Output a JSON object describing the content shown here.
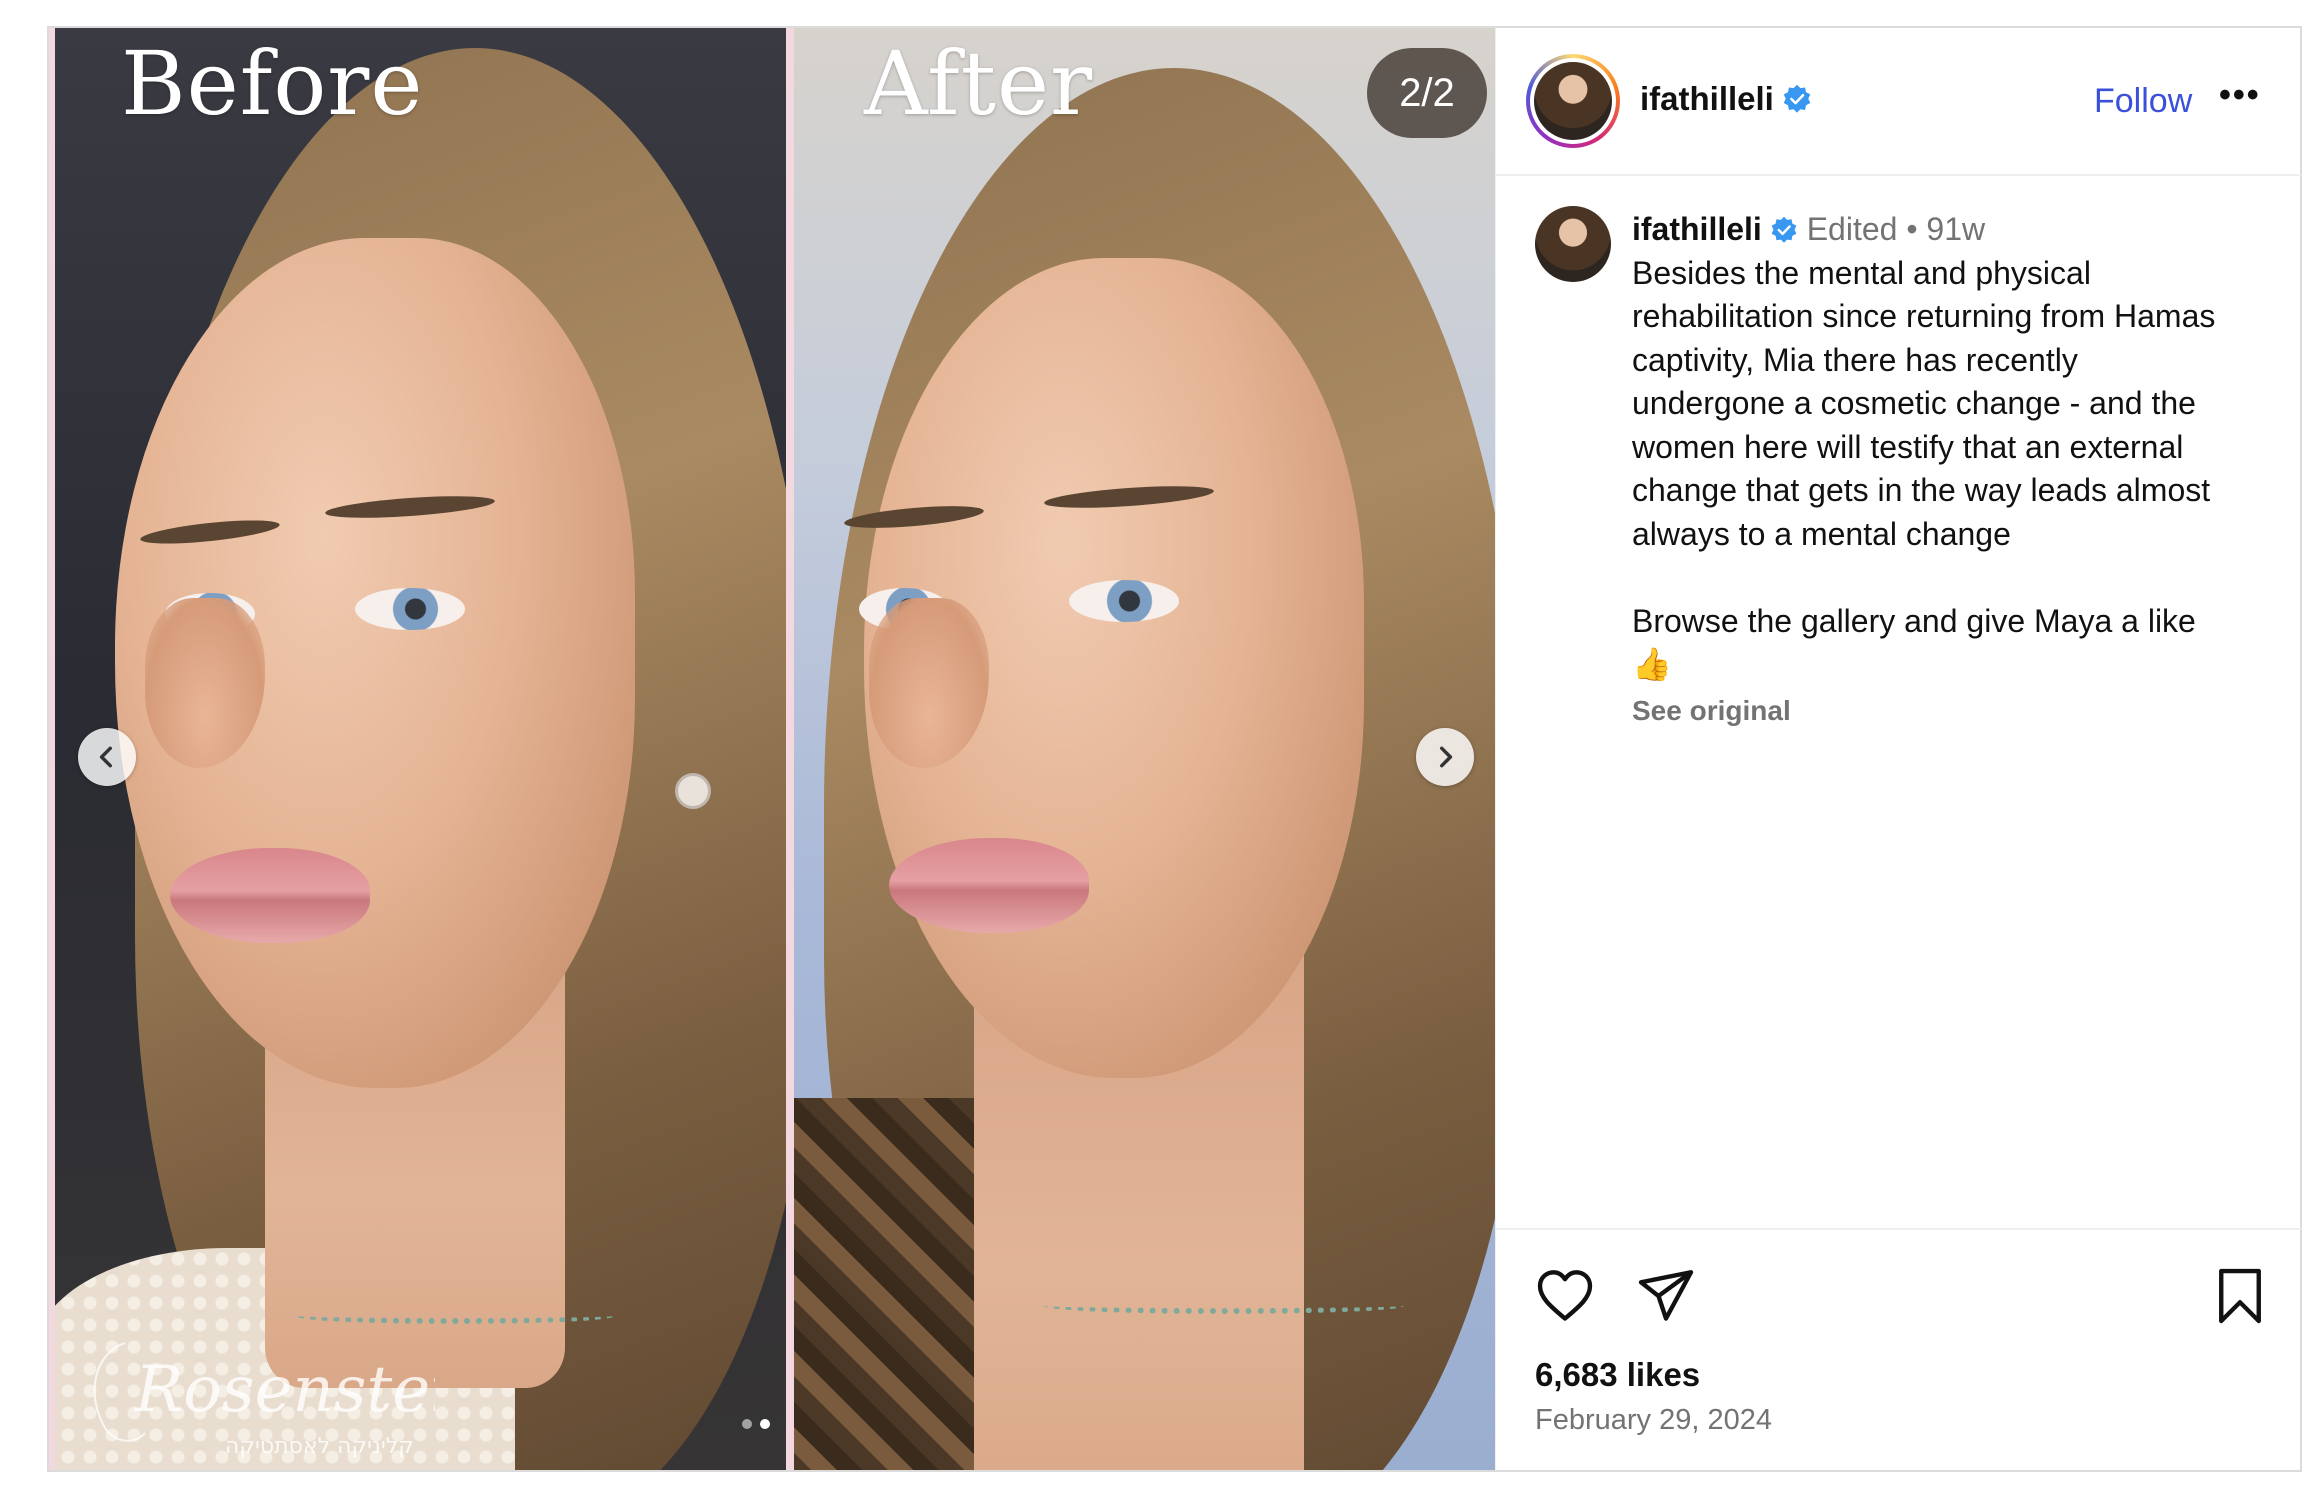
{
  "media": {
    "label_before": "Before",
    "label_after": "After",
    "slide_counter": "2/2",
    "total_slides": 2,
    "active_slide_index": 1,
    "watermark_name": "Rosenstein",
    "watermark_subtitle": "קליניקה לאסתטיקה"
  },
  "header": {
    "username": "ifathilleli",
    "verified": true,
    "follow_label": "Follow",
    "more_label": "•••"
  },
  "caption": {
    "username": "ifathilleli",
    "edited_label": "Edited",
    "separator": "•",
    "age": "91w",
    "lines": [
      "Besides the mental and physical",
      "rehabilitation since returning from Hamas",
      "captivity, Mia there has recently",
      "undergone a cosmetic change - and the",
      "women here will testify that an external",
      "change that gets in the way leads almost",
      "always to a mental change"
    ],
    "second_paragraph": "Browse the gallery and give Maya a like",
    "emoji": "👍",
    "see_original_label": "See original"
  },
  "actions": {
    "likes_text": "6,683 likes",
    "date_text": "February 29, 2024"
  },
  "colors": {
    "link_blue": "#3a50d9",
    "verified_blue": "#3897f0",
    "muted_text": "#737373",
    "border": "#dbdbdb"
  },
  "icons": [
    "heart-icon",
    "share-icon",
    "bookmark-icon",
    "verified-icon",
    "chevron-left-icon",
    "chevron-right-icon",
    "more-icon"
  ]
}
